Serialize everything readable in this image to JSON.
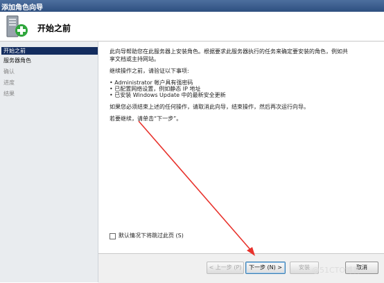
{
  "window": {
    "title": "添加角色向导"
  },
  "header": {
    "title": "开始之前"
  },
  "sidebar": {
    "items": [
      {
        "label": "开始之前",
        "state": "active"
      },
      {
        "label": "服务器角色",
        "state": "normal"
      },
      {
        "label": "确认",
        "state": "disabled"
      },
      {
        "label": "进度",
        "state": "disabled"
      },
      {
        "label": "结果",
        "state": "disabled"
      }
    ]
  },
  "content": {
    "p1_line1": "此向导帮助您在此服务器上安装角色。根据要求此服务器执行的任务来确定要安装的角色，例如共",
    "p1_line2": "享文档或主持网站。",
    "p2": "继续操作之前，请验证以下事项:",
    "bullets": [
      "• Administrator 帐户具有强密码",
      "• 已配置网络设置，例如静态 IP 地址",
      "• 已安装 Windows Update 中的最新安全更新"
    ],
    "p3": "如果您必须结束上述的任何操作，请取消此向导，结束操作，然后再次运行向导。",
    "p4": "若要继续，请单击“下一步”。",
    "checkbox_label": "默认情况下将跳过此页 (S)"
  },
  "footer": {
    "prev_label": "< 上一步 (P)",
    "next_label": "下一步 (N) >",
    "install_label": "安装",
    "cancel_label": "取消"
  },
  "watermark": "@51CTO博客",
  "colors": {
    "accent": "#132c5e",
    "annotation_arrow": "#e8322c"
  }
}
